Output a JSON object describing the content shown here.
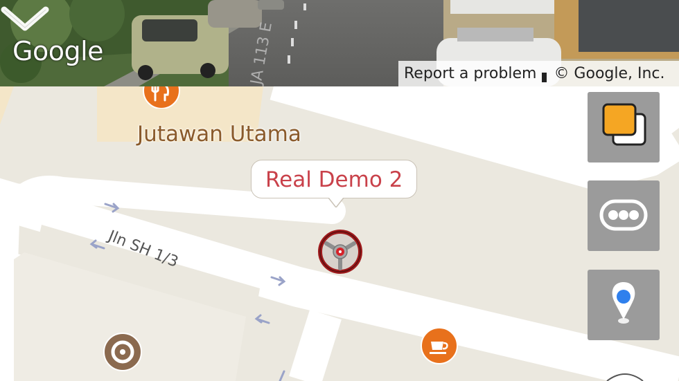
{
  "street_view": {
    "logo": "Google",
    "report_label": "Report a problem",
    "copyright": "© Google, Inc.",
    "collapse_icon": "chevron-down-icon"
  },
  "map": {
    "poi_restaurant_name": "Jutawan Utama",
    "street_name": "Jln SH 1/3",
    "marker_title": "Real Demo 2",
    "marker_icon": "steering-wheel-icon"
  },
  "controls": [
    {
      "name": "layers",
      "icon": "layers-icon"
    },
    {
      "name": "more",
      "icon": "more-dots-icon"
    },
    {
      "name": "my-location",
      "icon": "location-pin-icon"
    }
  ],
  "colors": {
    "map_bg": "#ebe8df",
    "road": "#ffffff",
    "poi_orange": "#e8711c",
    "poi_brown": "#8b6a4f",
    "marker_red": "#a3191c",
    "bubble_text": "#c9414a",
    "control_bg": "#9b9b9b",
    "layers_accent": "#f5a623",
    "location_blue": "#2f80ed"
  }
}
